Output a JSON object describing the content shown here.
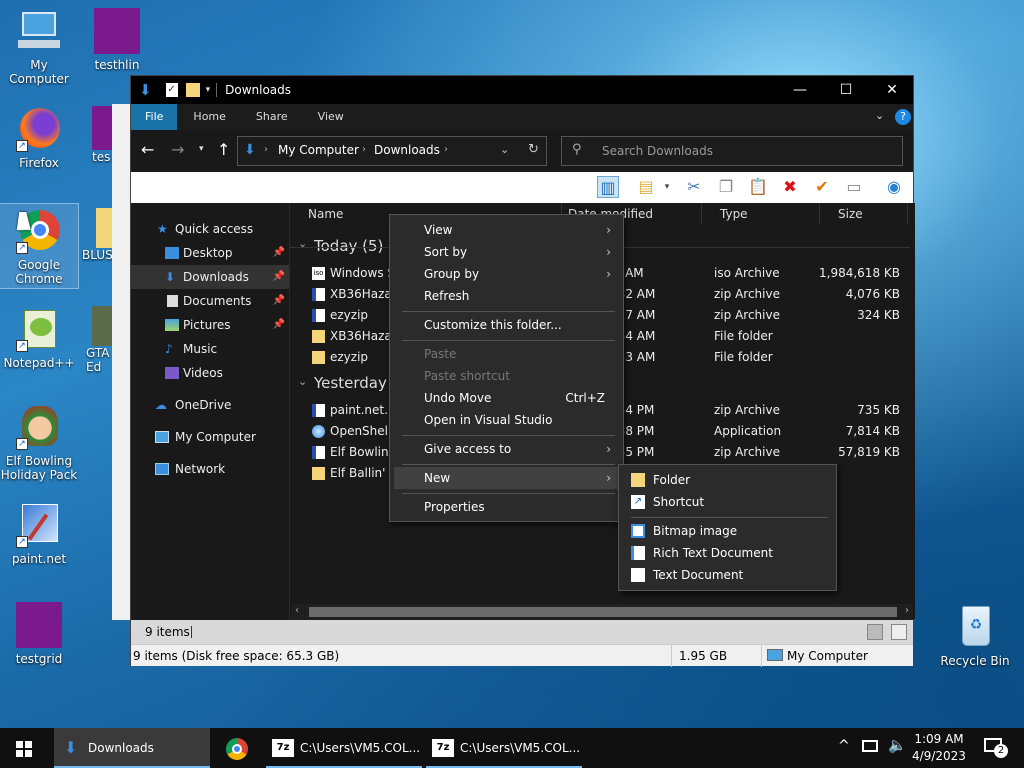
{
  "desktop": {
    "icons": [
      {
        "label": "My Computer"
      },
      {
        "label": "testhlin"
      },
      {
        "label": "Firefox"
      },
      {
        "label": "Google Chrome"
      },
      {
        "label": "Notepad++"
      },
      {
        "label": "Elf Bowling Holiday Pack"
      },
      {
        "label": "paint.net"
      },
      {
        "label": "testgrid"
      },
      {
        "label": "Recycle Bin"
      },
      {
        "label": "tes"
      },
      {
        "label": "BLUS"
      },
      {
        "label": "GTA Ed"
      }
    ]
  },
  "explorer": {
    "title": "Downloads",
    "ribbon_tabs": [
      "File",
      "Home",
      "Share",
      "View"
    ],
    "breadcrumb": [
      "My Computer",
      "Downloads"
    ],
    "search_placeholder": "Search Downloads",
    "nav": {
      "quick_access": "Quick access",
      "items": [
        "Desktop",
        "Downloads",
        "Documents",
        "Pictures",
        "Music",
        "Videos"
      ],
      "onedrive": "OneDrive",
      "my_computer": "My Computer",
      "network": "Network"
    },
    "columns": [
      "Name",
      "Date modified",
      "Type",
      "Size"
    ],
    "groups": {
      "today": "Today (5)",
      "yesterday": "Yesterday (4"
    },
    "files": [
      {
        "name": "Windows Se",
        "date": "04 AM",
        "type": "iso Archive",
        "size": "1,984,618 KB"
      },
      {
        "name": "XB36Hazard",
        "date": "2:32 AM",
        "type": "zip Archive",
        "size": "4,076 KB"
      },
      {
        "name": "ezyzip",
        "date": "2:27 AM",
        "type": "zip Archive",
        "size": "324 KB"
      },
      {
        "name": "XB36Hazard",
        "date": "2:34 AM",
        "type": "File folder",
        "size": ""
      },
      {
        "name": "ezyzip",
        "date": "2:33 AM",
        "type": "File folder",
        "size": ""
      },
      {
        "name": "paint.net.5.0",
        "date": "1:54 PM",
        "type": "zip Archive",
        "size": "735 KB"
      },
      {
        "name": "OpenShellSe",
        "date": "0:38 PM",
        "type": "Application",
        "size": "7,814 KB"
      },
      {
        "name": "Elf Bowling",
        "date": "0:35 PM",
        "type": "zip Archive",
        "size": "57,819 KB"
      },
      {
        "name": "Elf Ballin'",
        "date": "",
        "type": "",
        "size": ""
      }
    ],
    "status_items": "9 items",
    "status_disk": "9 items (Disk free space: 65.3 GB)",
    "status_size": "1.95 GB",
    "status_location": "My Computer"
  },
  "context_menu": {
    "view": "View",
    "sort_by": "Sort by",
    "group_by": "Group by",
    "refresh": "Refresh",
    "customize": "Customize this folder...",
    "paste": "Paste",
    "paste_shortcut": "Paste shortcut",
    "undo_move": "Undo Move",
    "undo_shortcut": "Ctrl+Z",
    "open_vs": "Open in Visual Studio",
    "give_access": "Give access to",
    "new": "New",
    "properties": "Properties"
  },
  "submenu_new": {
    "folder": "Folder",
    "shortcut": "Shortcut",
    "bitmap": "Bitmap image",
    "rtf": "Rich Text Document",
    "text": "Text Document"
  },
  "taskbar": {
    "downloads": "Downloads",
    "cmd1": "C:\\Users\\VM5.COL...",
    "cmd2": "C:\\Users\\VM5.COL...",
    "time": "1:09 AM",
    "date": "4/9/2023",
    "notif_count": "2"
  }
}
